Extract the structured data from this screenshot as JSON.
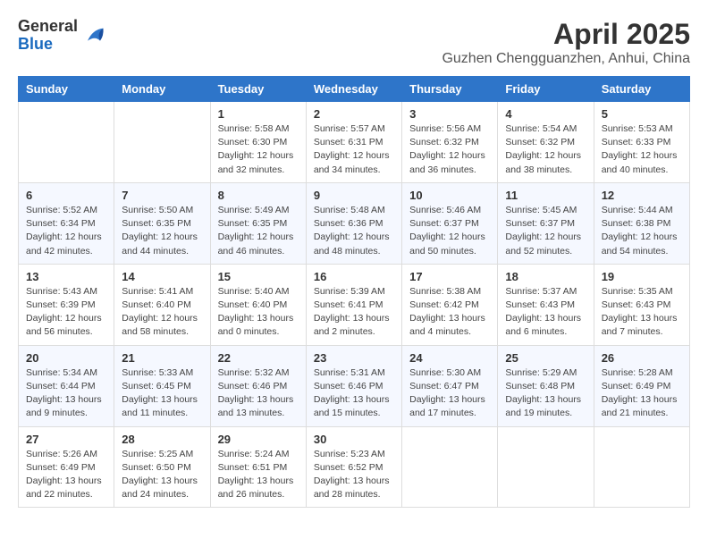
{
  "header": {
    "logo_general": "General",
    "logo_blue": "Blue",
    "month": "April 2025",
    "location": "Guzhen Chengguanzhen, Anhui, China"
  },
  "weekdays": [
    "Sunday",
    "Monday",
    "Tuesday",
    "Wednesday",
    "Thursday",
    "Friday",
    "Saturday"
  ],
  "weeks": [
    [
      {
        "day": "",
        "detail": ""
      },
      {
        "day": "",
        "detail": ""
      },
      {
        "day": "1",
        "detail": "Sunrise: 5:58 AM\nSunset: 6:30 PM\nDaylight: 12 hours\nand 32 minutes."
      },
      {
        "day": "2",
        "detail": "Sunrise: 5:57 AM\nSunset: 6:31 PM\nDaylight: 12 hours\nand 34 minutes."
      },
      {
        "day": "3",
        "detail": "Sunrise: 5:56 AM\nSunset: 6:32 PM\nDaylight: 12 hours\nand 36 minutes."
      },
      {
        "day": "4",
        "detail": "Sunrise: 5:54 AM\nSunset: 6:32 PM\nDaylight: 12 hours\nand 38 minutes."
      },
      {
        "day": "5",
        "detail": "Sunrise: 5:53 AM\nSunset: 6:33 PM\nDaylight: 12 hours\nand 40 minutes."
      }
    ],
    [
      {
        "day": "6",
        "detail": "Sunrise: 5:52 AM\nSunset: 6:34 PM\nDaylight: 12 hours\nand 42 minutes."
      },
      {
        "day": "7",
        "detail": "Sunrise: 5:50 AM\nSunset: 6:35 PM\nDaylight: 12 hours\nand 44 minutes."
      },
      {
        "day": "8",
        "detail": "Sunrise: 5:49 AM\nSunset: 6:35 PM\nDaylight: 12 hours\nand 46 minutes."
      },
      {
        "day": "9",
        "detail": "Sunrise: 5:48 AM\nSunset: 6:36 PM\nDaylight: 12 hours\nand 48 minutes."
      },
      {
        "day": "10",
        "detail": "Sunrise: 5:46 AM\nSunset: 6:37 PM\nDaylight: 12 hours\nand 50 minutes."
      },
      {
        "day": "11",
        "detail": "Sunrise: 5:45 AM\nSunset: 6:37 PM\nDaylight: 12 hours\nand 52 minutes."
      },
      {
        "day": "12",
        "detail": "Sunrise: 5:44 AM\nSunset: 6:38 PM\nDaylight: 12 hours\nand 54 minutes."
      }
    ],
    [
      {
        "day": "13",
        "detail": "Sunrise: 5:43 AM\nSunset: 6:39 PM\nDaylight: 12 hours\nand 56 minutes."
      },
      {
        "day": "14",
        "detail": "Sunrise: 5:41 AM\nSunset: 6:40 PM\nDaylight: 12 hours\nand 58 minutes."
      },
      {
        "day": "15",
        "detail": "Sunrise: 5:40 AM\nSunset: 6:40 PM\nDaylight: 13 hours\nand 0 minutes."
      },
      {
        "day": "16",
        "detail": "Sunrise: 5:39 AM\nSunset: 6:41 PM\nDaylight: 13 hours\nand 2 minutes."
      },
      {
        "day": "17",
        "detail": "Sunrise: 5:38 AM\nSunset: 6:42 PM\nDaylight: 13 hours\nand 4 minutes."
      },
      {
        "day": "18",
        "detail": "Sunrise: 5:37 AM\nSunset: 6:43 PM\nDaylight: 13 hours\nand 6 minutes."
      },
      {
        "day": "19",
        "detail": "Sunrise: 5:35 AM\nSunset: 6:43 PM\nDaylight: 13 hours\nand 7 minutes."
      }
    ],
    [
      {
        "day": "20",
        "detail": "Sunrise: 5:34 AM\nSunset: 6:44 PM\nDaylight: 13 hours\nand 9 minutes."
      },
      {
        "day": "21",
        "detail": "Sunrise: 5:33 AM\nSunset: 6:45 PM\nDaylight: 13 hours\nand 11 minutes."
      },
      {
        "day": "22",
        "detail": "Sunrise: 5:32 AM\nSunset: 6:46 PM\nDaylight: 13 hours\nand 13 minutes."
      },
      {
        "day": "23",
        "detail": "Sunrise: 5:31 AM\nSunset: 6:46 PM\nDaylight: 13 hours\nand 15 minutes."
      },
      {
        "day": "24",
        "detail": "Sunrise: 5:30 AM\nSunset: 6:47 PM\nDaylight: 13 hours\nand 17 minutes."
      },
      {
        "day": "25",
        "detail": "Sunrise: 5:29 AM\nSunset: 6:48 PM\nDaylight: 13 hours\nand 19 minutes."
      },
      {
        "day": "26",
        "detail": "Sunrise: 5:28 AM\nSunset: 6:49 PM\nDaylight: 13 hours\nand 21 minutes."
      }
    ],
    [
      {
        "day": "27",
        "detail": "Sunrise: 5:26 AM\nSunset: 6:49 PM\nDaylight: 13 hours\nand 22 minutes."
      },
      {
        "day": "28",
        "detail": "Sunrise: 5:25 AM\nSunset: 6:50 PM\nDaylight: 13 hours\nand 24 minutes."
      },
      {
        "day": "29",
        "detail": "Sunrise: 5:24 AM\nSunset: 6:51 PM\nDaylight: 13 hours\nand 26 minutes."
      },
      {
        "day": "30",
        "detail": "Sunrise: 5:23 AM\nSunset: 6:52 PM\nDaylight: 13 hours\nand 28 minutes."
      },
      {
        "day": "",
        "detail": ""
      },
      {
        "day": "",
        "detail": ""
      },
      {
        "day": "",
        "detail": ""
      }
    ]
  ]
}
